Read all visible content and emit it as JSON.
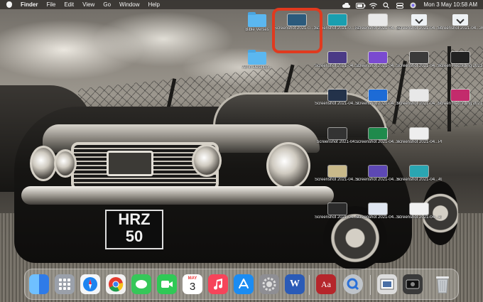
{
  "menubar": {
    "app_name": "Finder",
    "menus": [
      "File",
      "Edit",
      "View",
      "Go",
      "Window",
      "Help"
    ],
    "datetime": "Mon 3 May  10:58 AM"
  },
  "desktop_icons": [
    {
      "label": "Bible Verses",
      "kind": "folder"
    },
    {
      "label": "Screenshot 2021-0...39.16 PM",
      "kind": "screenshot",
      "thumb": "#2b5a7c"
    },
    {
      "label": "Screenshot 2021-0...7.26 PM",
      "kind": "screenshot",
      "thumb": "#1a9fb0"
    },
    {
      "label": "Screenshot 2021-04...27 PM",
      "kind": "screenshot",
      "thumb": "#e9e9e9"
    },
    {
      "label": "Screenshot 2021-04...PM",
      "kind": "screenshot",
      "thumb": "#f2f2f2"
    },
    {
      "label": "Screenshot 2021-04...36 PM",
      "kind": "screenshot",
      "thumb": "#f0f0f0"
    },
    {
      "label": "All in Desktop...",
      "kind": "folder"
    },
    {
      "label": "Screenshot 2021-04...28.25 PM",
      "kind": "screenshot",
      "thumb": "#4a3a86"
    },
    {
      "label": "Screenshot 2021-04...7.40 PM",
      "kind": "screenshot",
      "thumb": "#7a4ad0"
    },
    {
      "label": "Screenshot 2021-04...42 PM",
      "kind": "screenshot",
      "thumb": "#3a3a3a"
    },
    {
      "label": "Screen Recording 2021-04...",
      "kind": "screenshot",
      "thumb": "#222"
    },
    {
      "label": "Screenshot 2021-04...3 PM",
      "kind": "screenshot",
      "thumb": "#23324a"
    },
    {
      "label": "Screenshot 2021-04...PM",
      "kind": "screenshot",
      "thumb": "#1d6bd6"
    },
    {
      "label": "Screenshot 2021-04...PM",
      "kind": "screenshot",
      "thumb": "#e8e8e8"
    },
    {
      "label": "Screen Recording 2021-04...",
      "kind": "screenshot",
      "thumb": "#c32b6c"
    },
    {
      "label": "Screenshot 2021-04...",
      "kind": "screenshot",
      "thumb": "#333"
    },
    {
      "label": "Screenshot 2021-04...4.34 PM",
      "kind": "screenshot",
      "thumb": "#1f8a4c"
    },
    {
      "label": "Screenshot 2021-04...PM",
      "kind": "screenshot",
      "thumb": "#eee"
    },
    {
      "label": "Screenshot 2021-04...5.53 PM",
      "kind": "screenshot",
      "thumb": "#c9b98a"
    },
    {
      "label": "Screenshot 2021-04...6.37 PM",
      "kind": "screenshot",
      "thumb": "#5d48b4"
    },
    {
      "label": "Screenshot 2021-04...49 PM",
      "kind": "screenshot",
      "thumb": "#2aa6b2"
    },
    {
      "label": "Screenshot 2021-04...3.09 PM",
      "kind": "screenshot",
      "thumb": "#2b2b2b"
    },
    {
      "label": "Screenshot 2021-04...10.46 PM",
      "kind": "screenshot",
      "thumb": "#dfe6f0"
    },
    {
      "label": "Screenshot 2021-04...1.07 PM",
      "kind": "screenshot",
      "thumb": "#f1f1f1"
    }
  ],
  "license_plate": {
    "line1": "HRZ",
    "line2": "50"
  },
  "calendar": {
    "month": "MAY",
    "day": "3"
  },
  "dock_apps": [
    {
      "name": "finder-icon",
      "color": "#2f8ef0"
    },
    {
      "name": "launchpad-icon",
      "color": "#9aa0aa"
    },
    {
      "name": "safari-icon",
      "color": "#1d84f0"
    },
    {
      "name": "chrome-icon",
      "color": "#f2f2f2"
    },
    {
      "name": "messages-icon",
      "color": "#36c759"
    },
    {
      "name": "facetime-icon",
      "color": "#2fc956"
    },
    {
      "name": "calendar-icon",
      "color": "#ffffff"
    },
    {
      "name": "music-icon",
      "color": "#f6445a"
    },
    {
      "name": "app-store-icon",
      "color": "#1b8cf2"
    },
    {
      "name": "system-preferences-icon",
      "color": "#8e8e93"
    },
    {
      "name": "word-icon",
      "color": "#2b5bb7"
    },
    {
      "name": "dictionary-icon",
      "color": "#b5262b"
    },
    {
      "name": "quicktime-icon",
      "color": "#bfc4ca"
    },
    {
      "name": "preview-icon",
      "color": "#dcdcdc"
    },
    {
      "name": "screenshot-app-icon",
      "color": "#3a3a3a"
    },
    {
      "name": "trash-icon",
      "color": "#c8ccd0"
    }
  ],
  "colors": {
    "highlight": "#e03a1f"
  }
}
